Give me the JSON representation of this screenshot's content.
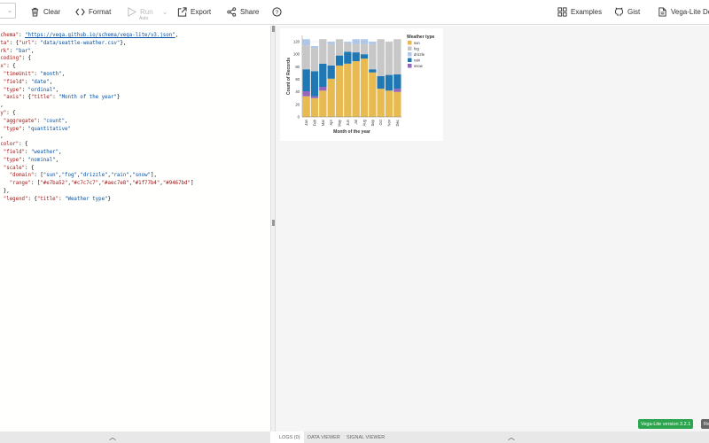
{
  "header": {
    "clear": "Clear",
    "format": "Format",
    "run": "Run",
    "auto": "Auto",
    "export": "Export",
    "share": "Share",
    "examples": "Examples",
    "gist": "Gist",
    "docs": "Vega-Lite Docs"
  },
  "editor": {
    "lines": [
      [
        [
          "  ",
          ""
        ],
        [
          "\"$schema\"",
          "k"
        ],
        [
          ": ",
          ""
        ],
        [
          "\"https://vega.github.io/schema/vega-lite/v3.json\"",
          "u"
        ],
        [
          ",",
          ""
        ]
      ],
      [
        [
          "  ",
          ""
        ],
        [
          "\"data\"",
          "k"
        ],
        [
          ": {",
          ""
        ],
        [
          "\"url\"",
          "k"
        ],
        [
          ": ",
          ""
        ],
        [
          "\"data/seattle-weather.csv\"",
          "s"
        ],
        [
          "},",
          ""
        ]
      ],
      [
        [
          "  ",
          ""
        ],
        [
          "\"mark\"",
          "k"
        ],
        [
          ": ",
          ""
        ],
        [
          "\"bar\"",
          "s"
        ],
        [
          ",",
          ""
        ]
      ],
      [
        [
          "  ",
          ""
        ],
        [
          "\"encoding\"",
          "k"
        ],
        [
          ": {",
          ""
        ]
      ],
      [
        [
          "    ",
          ""
        ],
        [
          "\"x\"",
          "k"
        ],
        [
          ": {",
          ""
        ]
      ],
      [
        [
          "      ",
          ""
        ],
        [
          "\"timeUnit\"",
          "k"
        ],
        [
          ": ",
          ""
        ],
        [
          "\"month\"",
          "s"
        ],
        [
          ",",
          ""
        ]
      ],
      [
        [
          "      ",
          ""
        ],
        [
          "\"field\"",
          "k"
        ],
        [
          ": ",
          ""
        ],
        [
          "\"date\"",
          "s"
        ],
        [
          ",",
          ""
        ]
      ],
      [
        [
          "      ",
          ""
        ],
        [
          "\"type\"",
          "k"
        ],
        [
          ": ",
          ""
        ],
        [
          "\"ordinal\"",
          "s"
        ],
        [
          ",",
          ""
        ]
      ],
      [
        [
          "      ",
          ""
        ],
        [
          "\"axis\"",
          "k"
        ],
        [
          ": {",
          ""
        ],
        [
          "\"title\"",
          "k"
        ],
        [
          ": ",
          ""
        ],
        [
          "\"Month of the year\"",
          "s"
        ],
        [
          "}",
          ""
        ]
      ],
      [
        [
          "    },",
          ""
        ]
      ],
      [
        [
          "    ",
          ""
        ],
        [
          "\"y\"",
          "k"
        ],
        [
          ": {",
          ""
        ]
      ],
      [
        [
          "      ",
          ""
        ],
        [
          "\"aggregate\"",
          "k"
        ],
        [
          ": ",
          ""
        ],
        [
          "\"count\"",
          "s"
        ],
        [
          ",",
          ""
        ]
      ],
      [
        [
          "      ",
          ""
        ],
        [
          "\"type\"",
          "k"
        ],
        [
          ": ",
          ""
        ],
        [
          "\"quantitative\"",
          "s"
        ]
      ],
      [
        [
          "    },",
          ""
        ]
      ],
      [
        [
          "    ",
          ""
        ],
        [
          "\"color\"",
          "k"
        ],
        [
          ": {",
          ""
        ]
      ],
      [
        [
          "      ",
          ""
        ],
        [
          "\"field\"",
          "k"
        ],
        [
          ": ",
          ""
        ],
        [
          "\"weather\"",
          "s"
        ],
        [
          ",",
          ""
        ]
      ],
      [
        [
          "      ",
          ""
        ],
        [
          "\"type\"",
          "k"
        ],
        [
          ": ",
          ""
        ],
        [
          "\"nominal\"",
          "s"
        ],
        [
          ",",
          ""
        ]
      ],
      [
        [
          "      ",
          ""
        ],
        [
          "\"scale\"",
          "k"
        ],
        [
          ": {",
          ""
        ]
      ],
      [
        [
          "        ",
          ""
        ],
        [
          "\"domain\"",
          "k"
        ],
        [
          ": [",
          ""
        ],
        [
          "\"sun\"",
          "s"
        ],
        [
          ",",
          ""
        ],
        [
          "\"fog\"",
          "s"
        ],
        [
          ",",
          ""
        ],
        [
          "\"drizzle\"",
          "s"
        ],
        [
          ",",
          ""
        ],
        [
          "\"rain\"",
          "s"
        ],
        [
          ",",
          ""
        ],
        [
          "\"snow\"",
          "s"
        ],
        [
          "],",
          ""
        ]
      ],
      [
        [
          "        ",
          ""
        ],
        [
          "\"range\"",
          "k"
        ],
        [
          ": [",
          ""
        ],
        [
          "\"#e7ba52\"",
          "k"
        ],
        [
          ",",
          ""
        ],
        [
          "\"#c7c7c7\"",
          "k"
        ],
        [
          ",",
          ""
        ],
        [
          "\"#aec7e8\"",
          "k"
        ],
        [
          ",",
          ""
        ],
        [
          "\"#1f77b4\"",
          "k"
        ],
        [
          ",",
          ""
        ],
        [
          "\"#9467bd\"",
          "k"
        ],
        [
          "]",
          ""
        ]
      ],
      [
        [
          "      },",
          ""
        ]
      ],
      [
        [
          "      ",
          ""
        ],
        [
          "\"legend\"",
          "k"
        ],
        [
          ": {",
          ""
        ],
        [
          "\"title\"",
          "k"
        ],
        [
          ": ",
          ""
        ],
        [
          "\"Weather type\"",
          "s"
        ],
        [
          "}",
          ""
        ]
      ]
    ]
  },
  "chart_data": {
    "type": "bar",
    "stacked": true,
    "categories": [
      "Jan",
      "Feb",
      "Mar",
      "Apr",
      "May",
      "Jun",
      "Jul",
      "Aug",
      "Sep",
      "Oct",
      "Nov",
      "Dec"
    ],
    "series": [
      {
        "name": "sun",
        "color": "#e7ba52",
        "values": [
          33,
          30,
          42,
          61,
          82,
          85,
          89,
          93,
          71,
          45,
          42,
          40
        ]
      },
      {
        "name": "snow",
        "color": "#9467bd",
        "values": [
          8,
          3,
          6,
          0,
          0,
          0,
          0,
          0,
          0,
          0,
          0,
          5
        ]
      },
      {
        "name": "rain",
        "color": "#1f77b4",
        "values": [
          35,
          40,
          37,
          21,
          16,
          19,
          14,
          7,
          5,
          20,
          25,
          23
        ]
      },
      {
        "name": "fog",
        "color": "#c7c7c7",
        "values": [
          38,
          37,
          39,
          34,
          26,
          14,
          13,
          16,
          40,
          59,
          53,
          56
        ]
      },
      {
        "name": "drizzle",
        "color": "#aec7e8",
        "values": [
          10,
          3,
          0,
          4,
          0,
          2,
          8,
          8,
          4,
          0,
          0,
          0
        ]
      }
    ],
    "legend_order": [
      "sun",
      "fog",
      "drizzle",
      "rain",
      "snow"
    ],
    "legend_title": "Weather type",
    "legend_position": "right",
    "xlabel": "Month of the year",
    "ylabel": "Count of Records",
    "yticks": [
      0,
      20,
      40,
      60,
      80,
      100,
      120
    ],
    "ylim": [
      0,
      130
    ],
    "grid": true
  },
  "footer": {
    "version": "Vega-Lite version 3.2.1",
    "renderer": "Re",
    "tabs": [
      "LOGS (0)",
      "DATA VIEWER",
      "SIGNAL VIEWER"
    ]
  }
}
